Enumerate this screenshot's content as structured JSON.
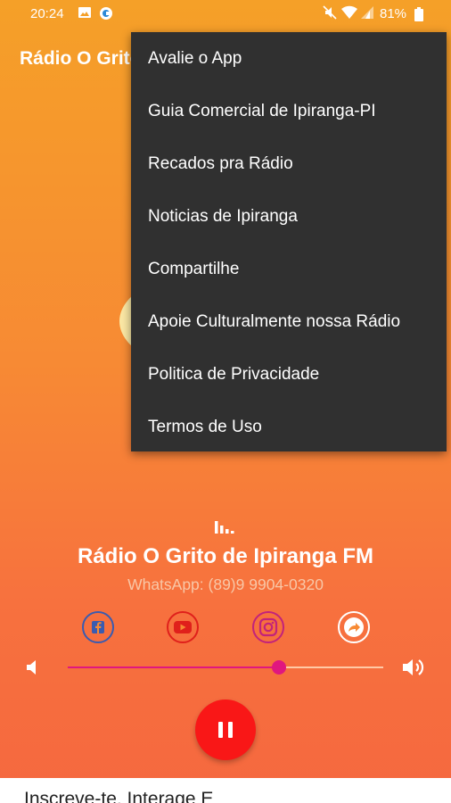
{
  "status_bar": {
    "time": "20:24",
    "battery": "81%"
  },
  "app_title": "Rádio O Grito de Ipiranga FM",
  "menu": {
    "items": [
      "Avalie o App",
      "Guia Comercial de Ipiranga-PI",
      "Recados pra Rádio",
      "Noticias de Ipiranga",
      "Compartilhe",
      "Apoie Culturalmente nossa Rádio",
      "Politica de Privacidade",
      "Termos de Uso"
    ]
  },
  "player": {
    "station_name": "Rádio O Grito de Ipiranga FM",
    "whatsapp": "WhatsApp: (89)9 9904-0320",
    "volume_fraction": 0.67,
    "state": "playing"
  },
  "social_icons": [
    "facebook-icon",
    "youtube-icon",
    "instagram-icon",
    "share-icon"
  ],
  "bottom_banner": {
    "text": "Inscreve-te, Interage E"
  },
  "colors": {
    "accent": "#e0177f",
    "play_button": "#f91717",
    "menu_bg": "#303030"
  }
}
